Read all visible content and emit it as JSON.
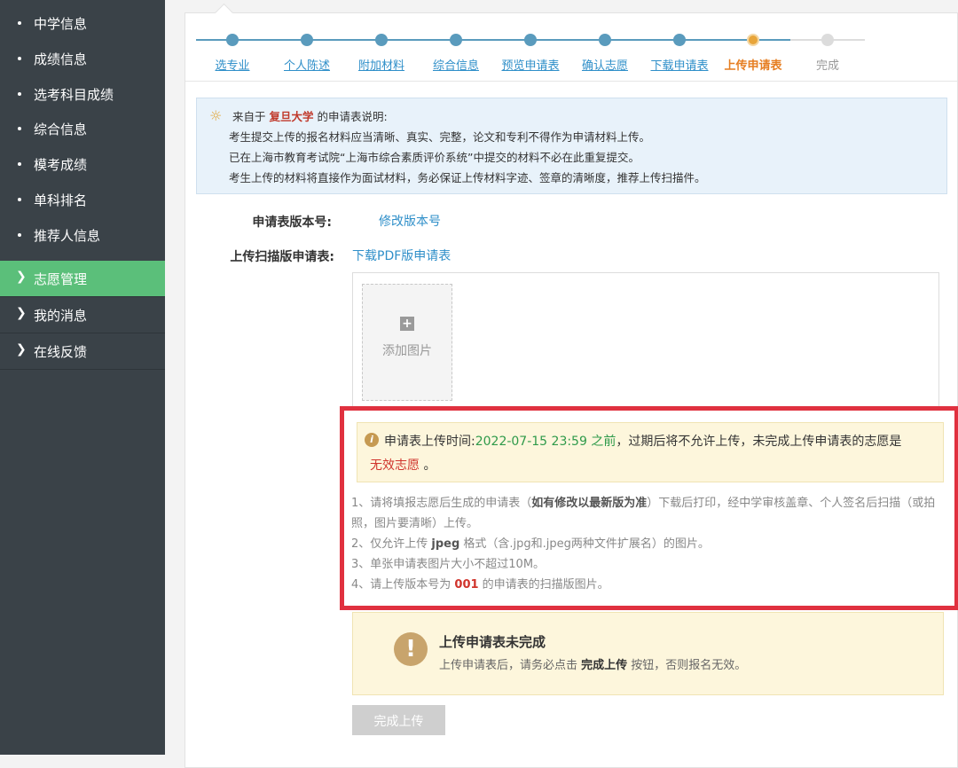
{
  "sidebar": {
    "sub_items": [
      "中学信息",
      "成绩信息",
      "选考科目成绩",
      "综合信息",
      "模考成绩",
      "单科排名",
      "推荐人信息"
    ],
    "main_items": [
      {
        "label": "志愿管理",
        "active": true
      },
      {
        "label": "我的消息",
        "active": false
      },
      {
        "label": "在线反馈",
        "active": false
      }
    ]
  },
  "steps": [
    {
      "label": "选专业",
      "state": "done"
    },
    {
      "label": "个人陈述",
      "state": "done"
    },
    {
      "label": "附加材料",
      "state": "done"
    },
    {
      "label": "综合信息",
      "state": "done"
    },
    {
      "label": "预览申请表",
      "state": "done"
    },
    {
      "label": "确认志愿",
      "state": "done"
    },
    {
      "label": "下载申请表",
      "state": "done"
    },
    {
      "label": "上传申请表",
      "state": "current"
    },
    {
      "label": "完成",
      "state": "todo"
    }
  ],
  "info": {
    "prefix": "来自于",
    "university": "复旦大学",
    "suffix": "的申请表说明:",
    "lines": [
      "考生提交上传的报名材料应当清晰、真实、完整，论文和专利不得作为申请材料上传。",
      "已在上海市教育考试院“上海市综合素质评价系统”中提交的材料不必在此重复提交。",
      "考生上传的材料将直接作为面试材料，务必保证上传材料字迹、签章的清晰度，推荐上传扫描件。"
    ]
  },
  "form": {
    "version_label": "申请表版本号:",
    "version_link": "修改版本号",
    "upload_label": "上传扫描版申请表:",
    "download_link": "下载PDF版申请表",
    "add_image": "添加图片"
  },
  "warning": {
    "lead": "申请表上传时间:",
    "deadline": "2022-07-15 23:59 之前",
    "middle": "，过期后将不允许上传，未完成上传申请表的志愿是",
    "invalid": "无效志愿",
    "end": "。"
  },
  "notes": {
    "n1a": "1、请将填报志愿后生成的申请表（",
    "n1b": "如有修改以最新版为准",
    "n1c": "）下载后打印，经中学审核盖章、个人签名后扫描（或拍",
    "n1d": "照，图片要清晰）上传。",
    "n2a": "2、仅允许上传 ",
    "n2b": "jpeg",
    "n2c": " 格式（含.jpg和.jpeg两种文件扩展名）的图片。",
    "n3": "3、单张申请表图片大小不超过10M。",
    "n4a": "4、请上传版本号为 ",
    "n4b": "001",
    "n4c": " 的申请表的扫描版图片。"
  },
  "incomplete": {
    "title": "上传申请表未完成",
    "sub_a": "上传申请表后，请务必点击 ",
    "sub_b": "完成上传",
    "sub_c": " 按钮，否则报名无效。"
  },
  "submit_button": "完成上传",
  "colors": {
    "accent": "#5bbf7a",
    "link": "#2f8fc9",
    "step_current": "#e8a53a",
    "alert_red": "#e0313f"
  }
}
